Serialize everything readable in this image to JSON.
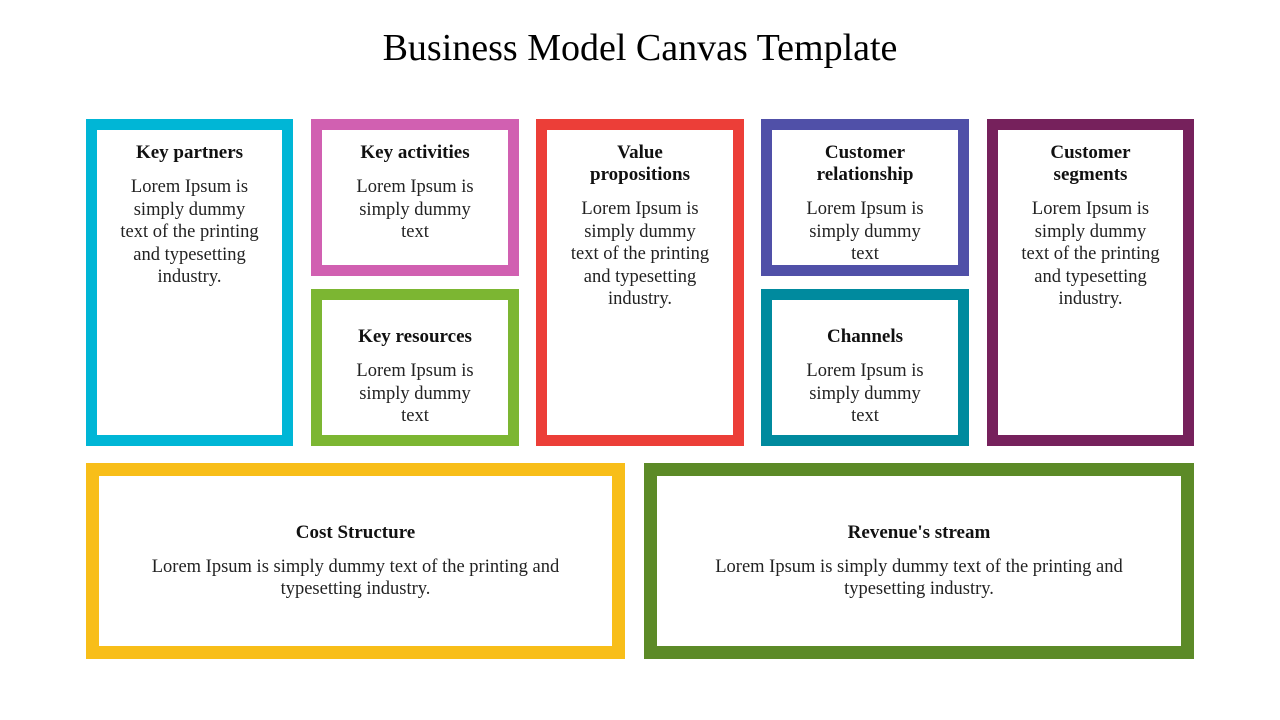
{
  "title": "Business Model Canvas Template",
  "colors": {
    "key_partners": "#00b6d6",
    "key_activities": "#d160b1",
    "key_resources": "#7cb632",
    "value_propositions": "#ec3e38",
    "customer_relationship": "#5050a8",
    "channels": "#008a9e",
    "customer_segments": "#76215c",
    "cost_structure": "#f8be19",
    "revenues_stream": "#5c8a27"
  },
  "blocks": {
    "key_partners": {
      "heading": "Key partners",
      "text": "Lorem Ipsum is simply dummy text of the printing and typesetting industry."
    },
    "key_activities": {
      "heading": "Key activities",
      "text": "Lorem Ipsum is simply dummy text"
    },
    "key_resources": {
      "heading": "Key resources",
      "text": "Lorem Ipsum is simply dummy text"
    },
    "value_propositions": {
      "heading": "Value propositions",
      "text": "Lorem Ipsum is simply dummy text of the printing and typesetting industry."
    },
    "customer_relationship": {
      "heading": "Customer relationship",
      "text": "Lorem Ipsum is simply dummy text"
    },
    "channels": {
      "heading": "Channels",
      "text": "Lorem Ipsum is simply dummy text"
    },
    "customer_segments": {
      "heading": "Customer segments",
      "text": "Lorem Ipsum is simply dummy text of the printing and typesetting industry."
    },
    "cost_structure": {
      "heading": "Cost Structure",
      "text": "Lorem Ipsum is simply dummy text of the printing and typesetting industry."
    },
    "revenues_stream": {
      "heading": "Revenue's stream",
      "text": "Lorem Ipsum is simply dummy text of the printing and typesetting industry."
    }
  }
}
